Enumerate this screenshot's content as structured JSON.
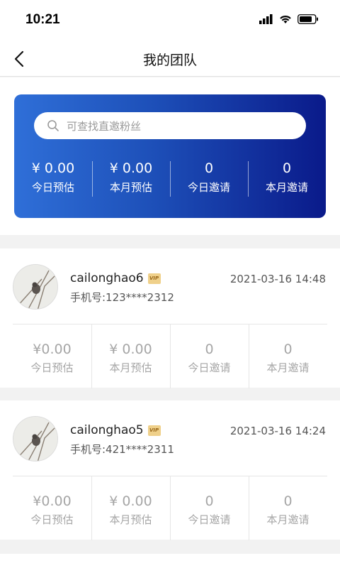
{
  "status_bar": {
    "time": "10:21"
  },
  "nav": {
    "title": "我的团队"
  },
  "search": {
    "placeholder": "可查找直邀粉丝"
  },
  "summary": [
    {
      "value": "¥ 0.00",
      "label": "今日预估"
    },
    {
      "value": "¥ 0.00",
      "label": "本月预估"
    },
    {
      "value": "0",
      "label": "今日邀请"
    },
    {
      "value": "0",
      "label": "本月邀请"
    }
  ],
  "members": [
    {
      "name": "cailonghao6",
      "badge": "VIP",
      "phone": "手机号:123****2312",
      "date": "2021-03-16 14:48",
      "stats": [
        {
          "value": "¥0.00",
          "label": "今日预估"
        },
        {
          "value": "¥ 0.00",
          "label": "本月预估"
        },
        {
          "value": "0",
          "label": "今日邀请"
        },
        {
          "value": "0",
          "label": "本月邀请"
        }
      ]
    },
    {
      "name": "cailonghao5",
      "badge": "VIP",
      "phone": "手机号:421****2311",
      "date": "2021-03-16 14:24",
      "stats": [
        {
          "value": "¥0.00",
          "label": "今日预估"
        },
        {
          "value": "¥ 0.00",
          "label": "本月预估"
        },
        {
          "value": "0",
          "label": "今日邀请"
        },
        {
          "value": "0",
          "label": "本月邀请"
        }
      ]
    }
  ],
  "colors": {
    "card_start": "#2f6fd8",
    "card_end": "#0a1a8a",
    "muted_text": "#a6a6a6"
  }
}
